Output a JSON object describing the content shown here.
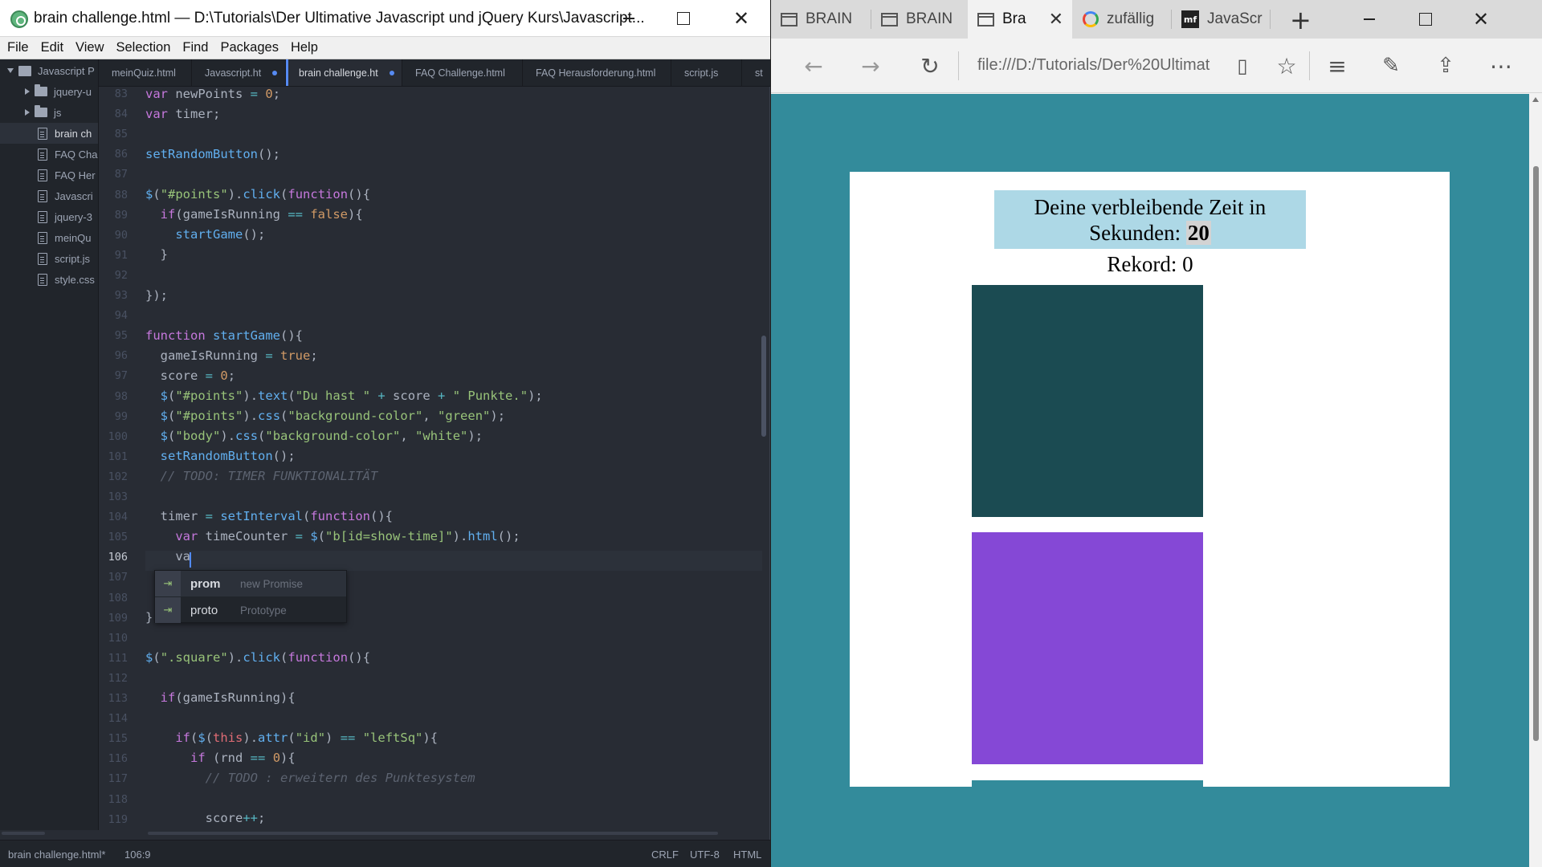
{
  "atom": {
    "window_title": "brain challenge.html — D:\\Tutorials\\Der Ultimative Javascript und jQuery Kurs\\Javascript...",
    "menu": [
      "File",
      "Edit",
      "View",
      "Selection",
      "Find",
      "Packages",
      "Help"
    ],
    "tree": [
      {
        "label": "Javascript P",
        "type": "repo"
      },
      {
        "label": "jquery-u",
        "type": "folder"
      },
      {
        "label": "js",
        "type": "folder"
      },
      {
        "label": "brain ch",
        "type": "file",
        "active": true
      },
      {
        "label": "FAQ Cha",
        "type": "file"
      },
      {
        "label": "FAQ Her",
        "type": "file"
      },
      {
        "label": "Javascri",
        "type": "file"
      },
      {
        "label": "jquery-3",
        "type": "file"
      },
      {
        "label": "meinQu",
        "type": "file"
      },
      {
        "label": "script.js",
        "type": "file"
      },
      {
        "label": "style.css",
        "type": "file"
      }
    ],
    "tabs": [
      {
        "label": "meinQuiz.html"
      },
      {
        "label": "Javascript.ht"
      },
      {
        "label": "brain challenge.ht"
      },
      {
        "label": "FAQ Challenge.html"
      },
      {
        "label": "FAQ Herausforderung.html"
      },
      {
        "label": "script.js"
      },
      {
        "label": "st"
      }
    ],
    "line_numbers": [
      "83",
      "84",
      "85",
      "86",
      "87",
      "88",
      "89",
      "90",
      "91",
      "92",
      "93",
      "94",
      "95",
      "96",
      "97",
      "98",
      "99",
      "100",
      "101",
      "102",
      "103",
      "104",
      "105",
      "106",
      "107",
      "108",
      "109",
      "110",
      "111",
      "112",
      "113",
      "114",
      "115",
      "116",
      "117",
      "118",
      "119"
    ],
    "current_line": "106",
    "autocomplete": [
      {
        "icon": "⇥",
        "text": "prom",
        "desc": "new Promise"
      },
      {
        "icon": "⇥",
        "text": "proto",
        "desc": "Prototype"
      }
    ],
    "status": {
      "file": "brain challenge.html*",
      "cursor": "106:9",
      "line_ending": "CRLF",
      "encoding": "UTF-8",
      "grammar": "HTML"
    }
  },
  "edge": {
    "tabs": [
      {
        "label": "BRAIN",
        "icon": "page-icon"
      },
      {
        "label": "BRAIN",
        "icon": "page-icon"
      },
      {
        "label": "Bra",
        "icon": "page-icon",
        "active": true
      },
      {
        "label": "zufällig",
        "icon": "google-icon"
      },
      {
        "label": "JavaScr",
        "icon": "mf-icon"
      }
    ],
    "mf_icon_text": "mf",
    "address": "file:///D:/Tutorials/Der%20Ultimat",
    "page": {
      "timer_line1": "Deine verbleibende Zeit in",
      "timer_line2_prefix": "Sekunden: ",
      "time_value": "20",
      "record": "Rekord: 0"
    },
    "colors": {
      "background": "#338b9b",
      "timer_box": "#add8e6",
      "square_1": "#1b4b52",
      "square_2": "#8548d6"
    }
  }
}
